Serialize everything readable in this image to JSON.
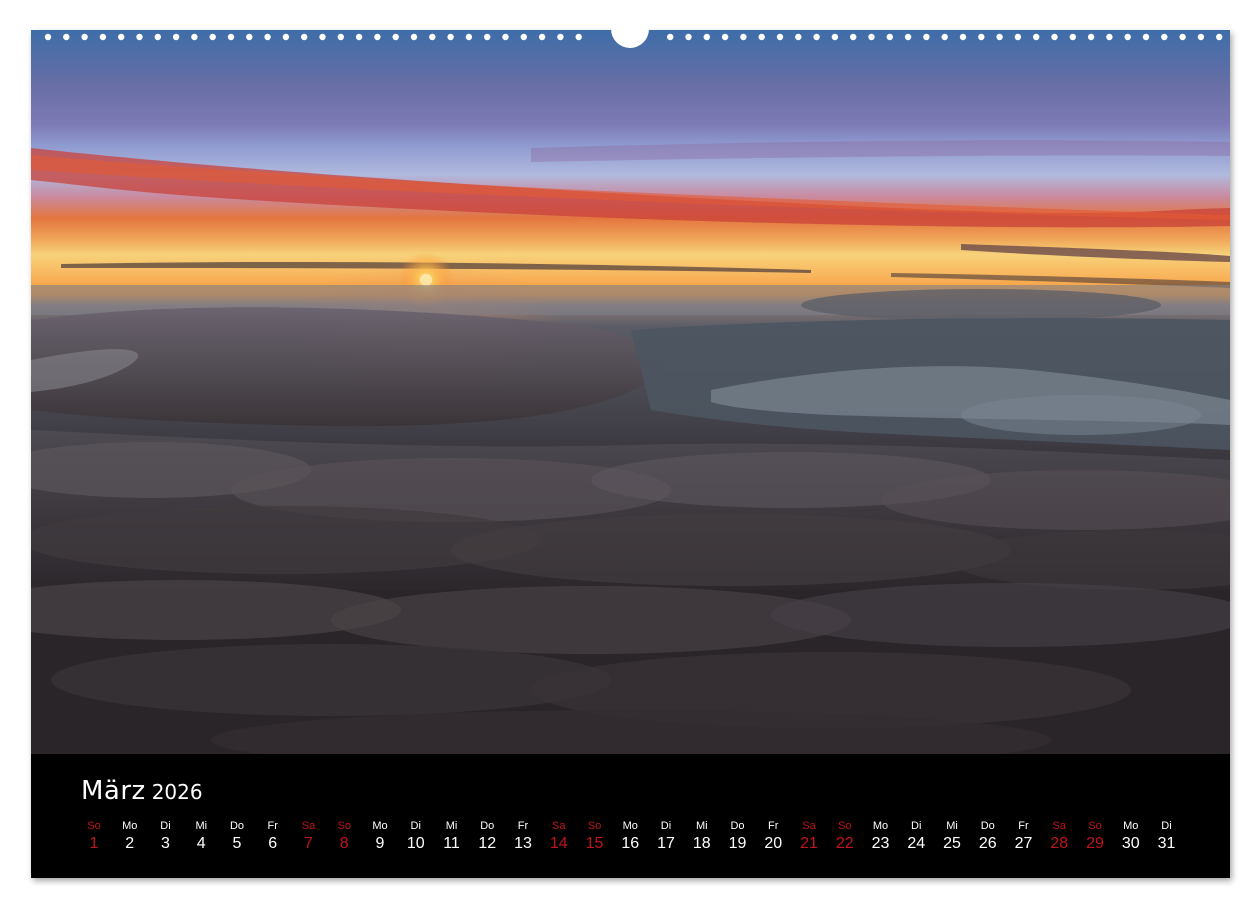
{
  "calendar": {
    "month": "März",
    "year": "2026",
    "photo_description_icon": "sunset-above-clouds-photo",
    "weekend_color": "#c0141c",
    "text_color": "#ffffff",
    "days": [
      {
        "abbr": "So",
        "num": "1",
        "weekend": true
      },
      {
        "abbr": "Mo",
        "num": "2",
        "weekend": false
      },
      {
        "abbr": "Di",
        "num": "3",
        "weekend": false
      },
      {
        "abbr": "Mi",
        "num": "4",
        "weekend": false
      },
      {
        "abbr": "Do",
        "num": "5",
        "weekend": false
      },
      {
        "abbr": "Fr",
        "num": "6",
        "weekend": false
      },
      {
        "abbr": "Sa",
        "num": "7",
        "weekend": true
      },
      {
        "abbr": "So",
        "num": "8",
        "weekend": true
      },
      {
        "abbr": "Mo",
        "num": "9",
        "weekend": false
      },
      {
        "abbr": "Di",
        "num": "10",
        "weekend": false
      },
      {
        "abbr": "Mi",
        "num": "11",
        "weekend": false
      },
      {
        "abbr": "Do",
        "num": "12",
        "weekend": false
      },
      {
        "abbr": "Fr",
        "num": "13",
        "weekend": false
      },
      {
        "abbr": "Sa",
        "num": "14",
        "weekend": true
      },
      {
        "abbr": "So",
        "num": "15",
        "weekend": true
      },
      {
        "abbr": "Mo",
        "num": "16",
        "weekend": false
      },
      {
        "abbr": "Di",
        "num": "17",
        "weekend": false
      },
      {
        "abbr": "Mi",
        "num": "18",
        "weekend": false
      },
      {
        "abbr": "Do",
        "num": "19",
        "weekend": false
      },
      {
        "abbr": "Fr",
        "num": "20",
        "weekend": false
      },
      {
        "abbr": "Sa",
        "num": "21",
        "weekend": true
      },
      {
        "abbr": "So",
        "num": "22",
        "weekend": true
      },
      {
        "abbr": "Mo",
        "num": "23",
        "weekend": false
      },
      {
        "abbr": "Di",
        "num": "24",
        "weekend": false
      },
      {
        "abbr": "Mi",
        "num": "25",
        "weekend": false
      },
      {
        "abbr": "Do",
        "num": "26",
        "weekend": false
      },
      {
        "abbr": "Fr",
        "num": "27",
        "weekend": false
      },
      {
        "abbr": "Sa",
        "num": "28",
        "weekend": true
      },
      {
        "abbr": "So",
        "num": "29",
        "weekend": true
      },
      {
        "abbr": "Mo",
        "num": "30",
        "weekend": false
      },
      {
        "abbr": "Di",
        "num": "31",
        "weekend": false
      }
    ]
  }
}
